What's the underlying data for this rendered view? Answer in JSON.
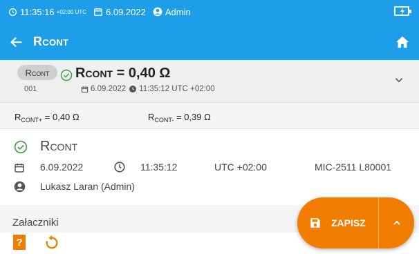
{
  "status_bar": {
    "time": "11:35:16",
    "timezone": "+02:00 UTC",
    "date": "6.09.2022",
    "user": "Admin",
    "icons": [
      "clock-icon",
      "calendar-icon",
      "account-icon",
      "battery-charging-icon"
    ]
  },
  "app_bar": {
    "title": "Rcont",
    "icons": [
      "back-arrow-icon",
      "home-icon"
    ]
  },
  "summary": {
    "chip_label": "Rcont",
    "chip_number": "001",
    "value_name": "Rcont",
    "value_text": " = 0,40 Ω",
    "date": "6.09.2022",
    "time": "11:35:12 UTC +02:00",
    "icons": [
      "check-circle-icon",
      "calendar-icon",
      "clock-icon",
      "chevron-down-icon"
    ]
  },
  "params": [
    {
      "base": "R",
      "sub": "CONT+",
      "value": " = 0,40 Ω"
    },
    {
      "base": "R",
      "sub": "CONT-",
      "value": " = 0,39 Ω"
    }
  ],
  "detail": {
    "title": "Rcont",
    "date": "6.09.2022",
    "time": "11:35:12",
    "utc": "UTC +02:00",
    "device": "MIC-2511 L80001",
    "user": "Lukasz Laran (Admin)"
  },
  "attachments": {
    "label": "Załaczniki"
  },
  "fab": {
    "save_label": "ZAPISZ"
  },
  "colors": {
    "primary": "#1e9ee9",
    "accent": "#f07d00",
    "ok": "#43a047"
  }
}
